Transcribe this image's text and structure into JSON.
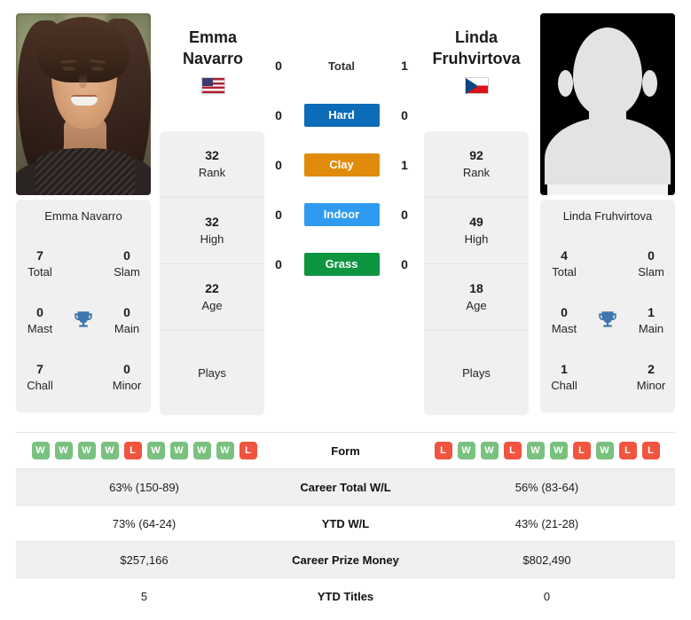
{
  "players": {
    "left": {
      "first_name": "Emma",
      "last_name": "Navarro",
      "full_name": "Emma Navarro",
      "country_flag": "flag-us-icon",
      "photo": "player-photo",
      "rank": "32",
      "rank_label": "Rank",
      "high": "32",
      "high_label": "High",
      "age": "22",
      "age_label": "Age",
      "plays": "Plays",
      "titles": {
        "total": "7",
        "total_label": "Total",
        "slam": "0",
        "slam_label": "Slam",
        "mast": "0",
        "mast_label": "Mast",
        "main": "0",
        "main_label": "Main",
        "chall": "7",
        "chall_label": "Chall",
        "minor": "0",
        "minor_label": "Minor",
        "trophy_icon": "trophy-icon"
      }
    },
    "right": {
      "first_name": "Linda",
      "last_name": "Fruhvirtova",
      "full_name": "Linda Fruhvirtova",
      "country_flag": "flag-cz-icon",
      "photo": "player-photo-placeholder",
      "rank": "92",
      "rank_label": "Rank",
      "high": "49",
      "high_label": "High",
      "age": "18",
      "age_label": "Age",
      "plays": "Plays",
      "titles": {
        "total": "4",
        "total_label": "Total",
        "slam": "0",
        "slam_label": "Slam",
        "mast": "0",
        "mast_label": "Mast",
        "main": "1",
        "main_label": "Main",
        "chall": "1",
        "chall_label": "Chall",
        "minor": "2",
        "minor_label": "Minor",
        "trophy_icon": "trophy-icon"
      }
    }
  },
  "h2h": {
    "rows": [
      {
        "left": "0",
        "label": "Total",
        "right": "1",
        "style": "plain",
        "color": ""
      },
      {
        "left": "0",
        "label": "Hard",
        "right": "0",
        "style": "button",
        "color": "#0c6cb8"
      },
      {
        "left": "0",
        "label": "Clay",
        "right": "1",
        "style": "button",
        "color": "#e08c0a"
      },
      {
        "left": "0",
        "label": "Indoor",
        "right": "0",
        "style": "button",
        "color": "#2f9bf0"
      },
      {
        "left": "0",
        "label": "Grass",
        "right": "0",
        "style": "button",
        "color": "#0e9541"
      }
    ]
  },
  "comparison": {
    "rows": [
      {
        "label": "Form",
        "type": "badges",
        "left_form": [
          "W",
          "W",
          "W",
          "W",
          "L",
          "W",
          "W",
          "W",
          "W",
          "L"
        ],
        "right_form": [
          "L",
          "W",
          "W",
          "L",
          "W",
          "W",
          "L",
          "W",
          "L",
          "L"
        ],
        "left": "",
        "right": ""
      },
      {
        "label": "Career Total W/L",
        "type": "text",
        "left": "63% (150-89)",
        "right": "56% (83-64)"
      },
      {
        "label": "YTD W/L",
        "type": "text",
        "left": "73% (64-24)",
        "right": "43% (21-28)"
      },
      {
        "label": "Career Prize Money",
        "type": "text",
        "left": "$257,166",
        "right": "$802,490"
      },
      {
        "label": "YTD Titles",
        "type": "text",
        "left": "5",
        "right": "0"
      }
    ]
  },
  "colors": {
    "hard": "#0c6cb8",
    "clay": "#e08c0a",
    "indoor": "#2f9bf0",
    "grass": "#0e9541",
    "win": "#7ac17f",
    "loss": "#f1543f",
    "card_bg": "#f0f0f0",
    "trophy": "#3e76ad"
  }
}
